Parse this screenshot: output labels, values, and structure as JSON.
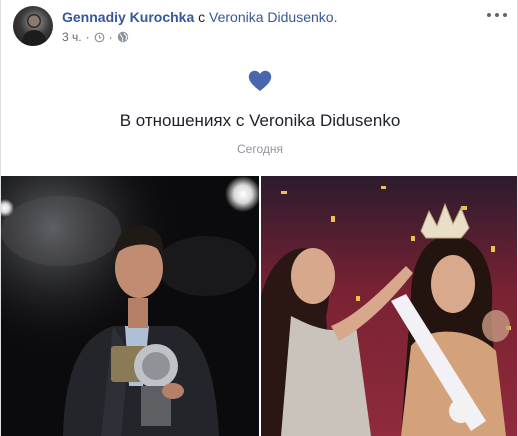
{
  "post": {
    "author": "Gennadiy Kurochka",
    "connector": "с",
    "partner": "Veronika Didusenko.",
    "time": "3 ч.",
    "separator": "·",
    "audience_icon": "globe-icon",
    "more_icon": "more-horizontal-icon"
  },
  "life_event": {
    "icon": "heart-icon",
    "icon_color": "#4a67ad",
    "title": "В отношениях с Veronika Didusenko",
    "date": "Сегодня"
  },
  "colors": {
    "link": "#365899",
    "text": "#1d2129",
    "meta": "#616770",
    "muted": "#90949c"
  },
  "photos": [
    {
      "name": "photo-man-with-award"
    },
    {
      "name": "photo-miss-ukraine-crowning"
    }
  ]
}
